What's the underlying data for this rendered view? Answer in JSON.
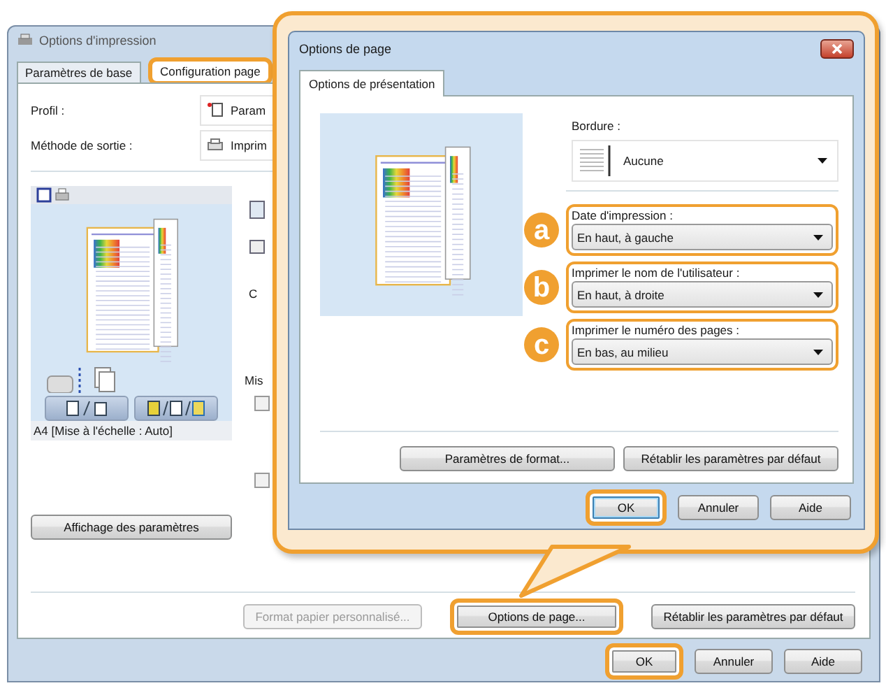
{
  "window": {
    "title": "Options d'impression"
  },
  "tabs": [
    {
      "label": "Paramètres de base",
      "selected": false,
      "highlighted": false
    },
    {
      "label": "Configuration page",
      "selected": true,
      "highlighted": true
    }
  ],
  "fields": [
    {
      "label": "Profil :",
      "value": "Param"
    },
    {
      "label": "Méthode de sortie :",
      "value": "Imprim"
    }
  ],
  "preview": {
    "caption": "A4 [Mise à l'échelle : Auto]"
  },
  "partial_labels": [
    "C",
    "Mis"
  ],
  "checkboxes": [
    {
      "checked": false
    },
    {
      "checked": false
    }
  ],
  "settings_button": "Affichage des paramètres",
  "bottom_buttons": [
    {
      "label": "Format papier personnalisé...",
      "disabled": true,
      "highlighted": false
    },
    {
      "label": "Options de page...",
      "disabled": false,
      "highlighted": true
    },
    {
      "label": "Rétablir les paramètres par défaut",
      "disabled": false,
      "highlighted": false
    }
  ],
  "dialog_buttons": [
    {
      "label": "OK",
      "highlighted": true
    },
    {
      "label": "Annuler",
      "highlighted": false
    },
    {
      "label": "Aide",
      "highlighted": false
    }
  ],
  "popup": {
    "title": "Options de page",
    "tab": "Options de présentation",
    "border": {
      "label": "Bordure :",
      "value": "Aucune"
    },
    "options": [
      {
        "marker": "a",
        "label": "Date d'impression :",
        "value": "En haut, à gauche",
        "highlighted": true
      },
      {
        "marker": "b",
        "label": "Imprimer le nom de l'utilisateur :",
        "value": "En haut, à droite",
        "highlighted": true
      },
      {
        "marker": "c",
        "label": "Imprimer le numéro des pages :",
        "value": "En bas, au milieu",
        "highlighted": true
      }
    ],
    "buttons": [
      {
        "label": "Paramètres de format..."
      },
      {
        "label": "Rétablir les paramètres par défaut"
      }
    ],
    "dialog_buttons": [
      {
        "label": "OK",
        "highlighted": true
      },
      {
        "label": "Annuler",
        "highlighted": false
      },
      {
        "label": "Aide",
        "highlighted": false
      }
    ]
  }
}
